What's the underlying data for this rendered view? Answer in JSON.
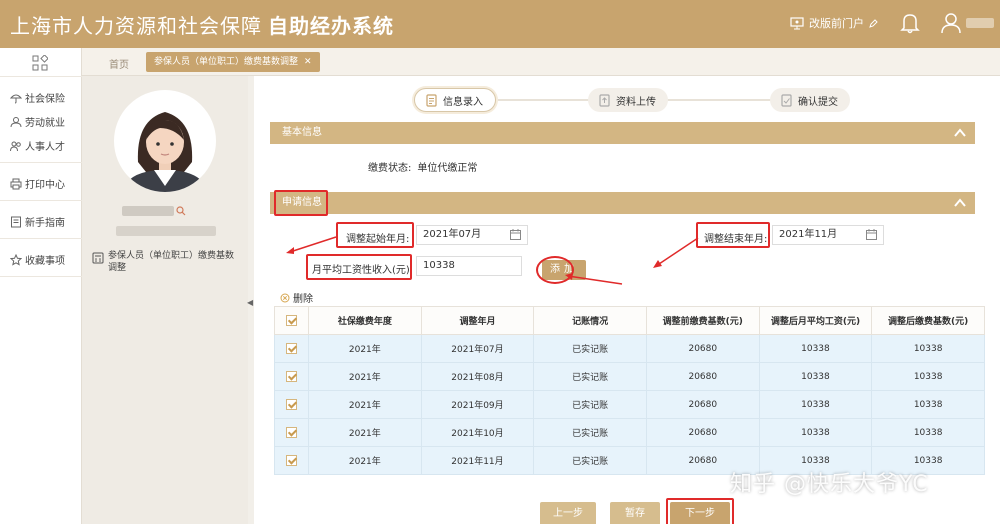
{
  "header": {
    "title_main": "上海市人力资源和社会保障",
    "title_sub": "自助经办系统",
    "portal_label": "改版前门户"
  },
  "leftnav": {
    "items": [
      {
        "label": "社会保险",
        "icon": "umbrella-icon"
      },
      {
        "label": "劳动就业",
        "icon": "worker-icon"
      },
      {
        "label": "人事人才",
        "icon": "people-icon"
      },
      {
        "label": "打印中心",
        "icon": "printer-icon"
      },
      {
        "label": "新手指南",
        "icon": "guide-icon"
      },
      {
        "label": "收藏事项",
        "icon": "star-icon"
      }
    ]
  },
  "tabs": {
    "home": "首页",
    "active": "参保人员（单位职工）缴费基数调整"
  },
  "profile": {
    "menu_label": "参保人员（单位职工）缴费基数调整"
  },
  "steps": [
    {
      "label": "信息录入",
      "icon": "form-icon",
      "active": true
    },
    {
      "label": "资料上传",
      "icon": "upload-icon",
      "active": false
    },
    {
      "label": "确认提交",
      "icon": "submit-icon",
      "active": false
    }
  ],
  "basic": {
    "header": "基本信息",
    "status_label": "缴费状态:",
    "status_value": "单位代缴正常"
  },
  "apply": {
    "header": "申请信息",
    "start_label": "调整起始年月:",
    "start_value": "2021年07月",
    "end_label": "调整结束年月:",
    "end_value": "2021年11月",
    "income_label": "月平均工资性收入(元):",
    "income_value": "10338",
    "add_label": "添加",
    "delete_label": "删除"
  },
  "table": {
    "columns": [
      "社保缴费年度",
      "调整年月",
      "记账情况",
      "调整前缴费基数(元)",
      "调整后月平均工资(元)",
      "调整后缴费基数(元)"
    ],
    "rows": [
      [
        "2021年",
        "2021年07月",
        "已实记账",
        "20680",
        "10338",
        "10338"
      ],
      [
        "2021年",
        "2021年08月",
        "已实记账",
        "20680",
        "10338",
        "10338"
      ],
      [
        "2021年",
        "2021年09月",
        "已实记账",
        "20680",
        "10338",
        "10338"
      ],
      [
        "2021年",
        "2021年10月",
        "已实记账",
        "20680",
        "10338",
        "10338"
      ],
      [
        "2021年",
        "2021年11月",
        "已实记账",
        "20680",
        "10338",
        "10338"
      ]
    ]
  },
  "footer": {
    "prev": "上一步",
    "save": "暂存",
    "next": "下一步"
  },
  "watermark": "知乎 @快乐大爷YC",
  "colors": {
    "brand": "#c8a46e",
    "section": "#d3b683",
    "highlight": "#e02a2a",
    "row_bg": "#e7f3fb"
  }
}
